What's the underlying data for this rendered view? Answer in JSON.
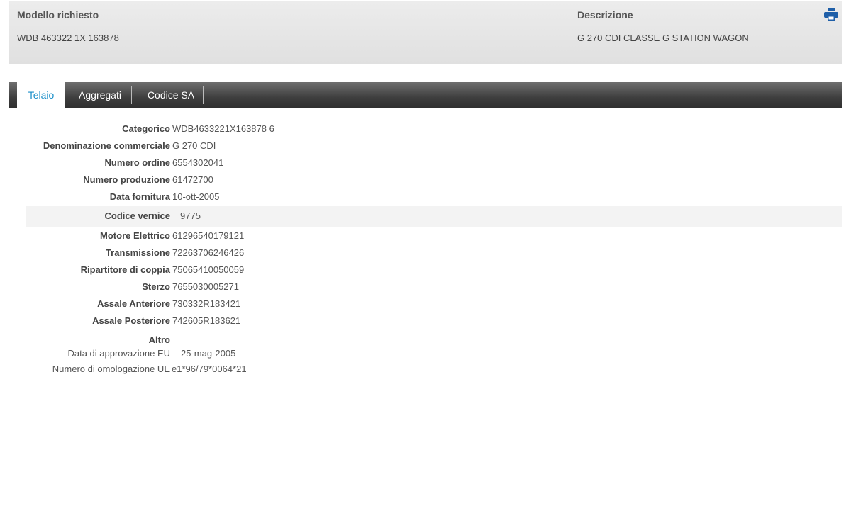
{
  "header": {
    "model_label": "Modello richiesto",
    "model_value": "WDB 463322 1X 163878",
    "description_label": "Descrizione",
    "description_value": "G 270 CDI CLASSE G STATION WAGON",
    "print_icon": "print-icon"
  },
  "tabs": [
    {
      "label": "Telaio",
      "active": true
    },
    {
      "label": "Aggregati",
      "active": false
    },
    {
      "label": "Codice SA",
      "active": false
    }
  ],
  "colors": {
    "active_tab_text": "#1a8fc9",
    "tabbar_dark": "#2f2f2f",
    "print_icon": "#1f5fa8"
  },
  "details": [
    {
      "label": "Categorico",
      "value": "WDB4633221X163878 6"
    },
    {
      "label": "Denominazione commerciale",
      "value": "G 270 CDI"
    },
    {
      "label": "Numero ordine",
      "value": "6554302041"
    },
    {
      "label": "Numero produzione",
      "value": "61472700"
    },
    {
      "label": "Data fornitura",
      "value": "10-ott-2005"
    },
    {
      "label": "Codice vernice",
      "value": "9775"
    },
    {
      "label": "Motore Elettrico",
      "value": "61296540179121"
    },
    {
      "label": "Transmissione",
      "value": "72263706246426"
    },
    {
      "label": "Ripartitore di coppia",
      "value": "75065410050059"
    },
    {
      "label": "Sterzo",
      "value": "7655030005271"
    },
    {
      "label": "Assale Anteriore",
      "value": "730332R183421"
    },
    {
      "label": "Assale Posteriore",
      "value": "742605R183621"
    },
    {
      "label": "Altro",
      "value": ""
    },
    {
      "label": "Data di approvazione EU",
      "value": "25-mag-2005"
    },
    {
      "label": "Numero di omologazione UE",
      "value": "e1*96/79*0064*21"
    }
  ]
}
